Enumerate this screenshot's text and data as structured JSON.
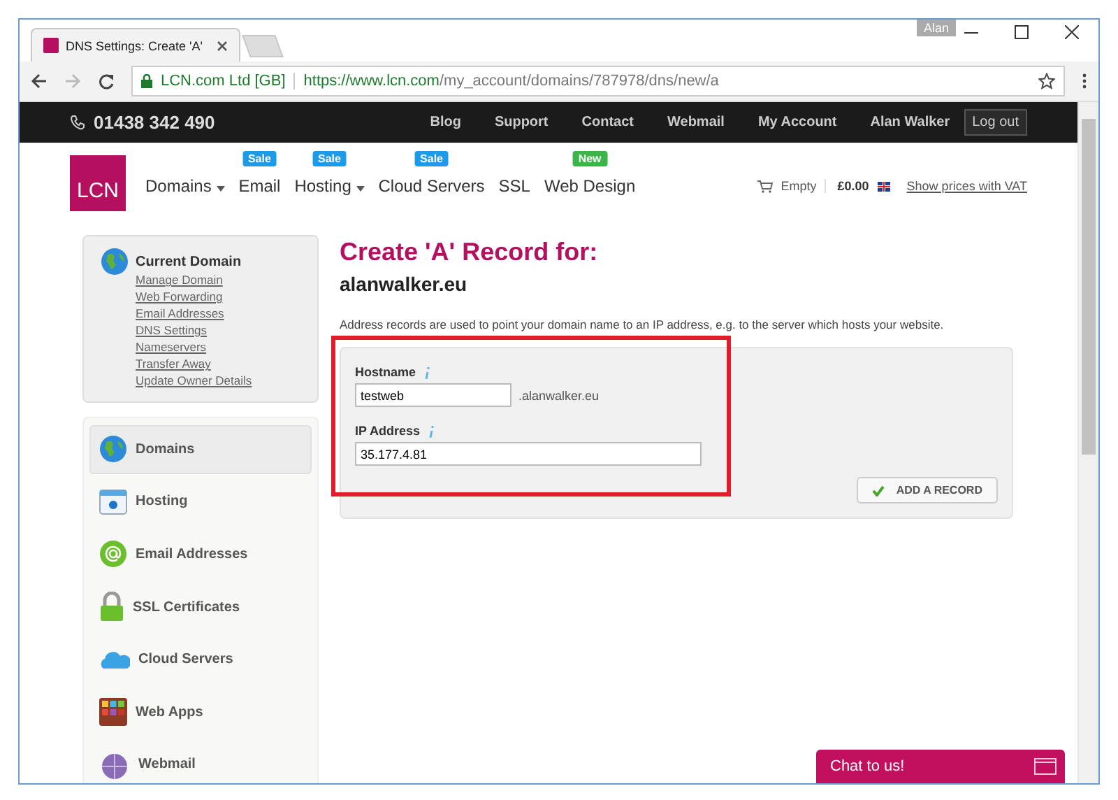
{
  "browser": {
    "tab_title": "DNS Settings: Create 'A'",
    "profile": "Alan",
    "site_identity": "LCN.com Ltd [GB]",
    "url_host": "https://www.lcn.com",
    "url_path": "/my_account/domains/787978/dns/new/a"
  },
  "topbar": {
    "phone": "01438 342 490",
    "links": [
      "Blog",
      "Support",
      "Contact",
      "Webmail",
      "My Account"
    ],
    "user": "Alan Walker",
    "logout": "Log out"
  },
  "nav": {
    "logo": "LCN",
    "items": [
      {
        "label": "Domains",
        "dropdown": true
      },
      {
        "label": "Email",
        "dropdown": false,
        "badge": "Sale",
        "color": "#1e9be8"
      },
      {
        "label": "Hosting",
        "dropdown": true,
        "badge": "Sale",
        "color": "#1e9be8"
      },
      {
        "label": "Cloud Servers",
        "dropdown": false,
        "badge": "Sale",
        "color": "#1e9be8"
      },
      {
        "label": "SSL",
        "dropdown": false
      },
      {
        "label": "Web Design",
        "dropdown": false,
        "badge": "New",
        "color": "#3bb54a"
      }
    ],
    "cart": {
      "status": "Empty",
      "total": "£0.00",
      "vat_link": "Show prices with VAT"
    }
  },
  "sidebar": {
    "current_domain": {
      "title": "Current Domain",
      "links": [
        "Manage Domain",
        "Web Forwarding",
        "Email Addresses",
        "DNS Settings",
        "Nameservers",
        "Transfer Away",
        "Update Owner Details"
      ]
    },
    "menu": [
      {
        "label": "Domains",
        "kind": "globe",
        "selected": true
      },
      {
        "label": "Hosting",
        "kind": "browser",
        "selected": false
      },
      {
        "label": "Email Addresses",
        "kind": "at",
        "selected": false
      },
      {
        "label": "SSL Certificates",
        "kind": "lock",
        "selected": false
      },
      {
        "label": "Cloud Servers",
        "kind": "cloud",
        "selected": false
      },
      {
        "label": "Web Apps",
        "kind": "grid",
        "selected": false
      },
      {
        "label": "Webmail",
        "kind": "mailglobe",
        "selected": false
      }
    ]
  },
  "main": {
    "title": "Create 'A' Record for:",
    "domain": "alanwalker.eu",
    "description": "Address records are used to point your domain name to an IP address, e.g. to the server which hosts your website.",
    "fields": [
      {
        "label": "Hostname",
        "value": "testweb",
        "suffix": ".alanwalker.eu"
      },
      {
        "label": "IP Address",
        "value": "35.177.4.81"
      }
    ],
    "submit": "ADD A RECORD"
  },
  "chat": {
    "label": "Chat to us!"
  }
}
